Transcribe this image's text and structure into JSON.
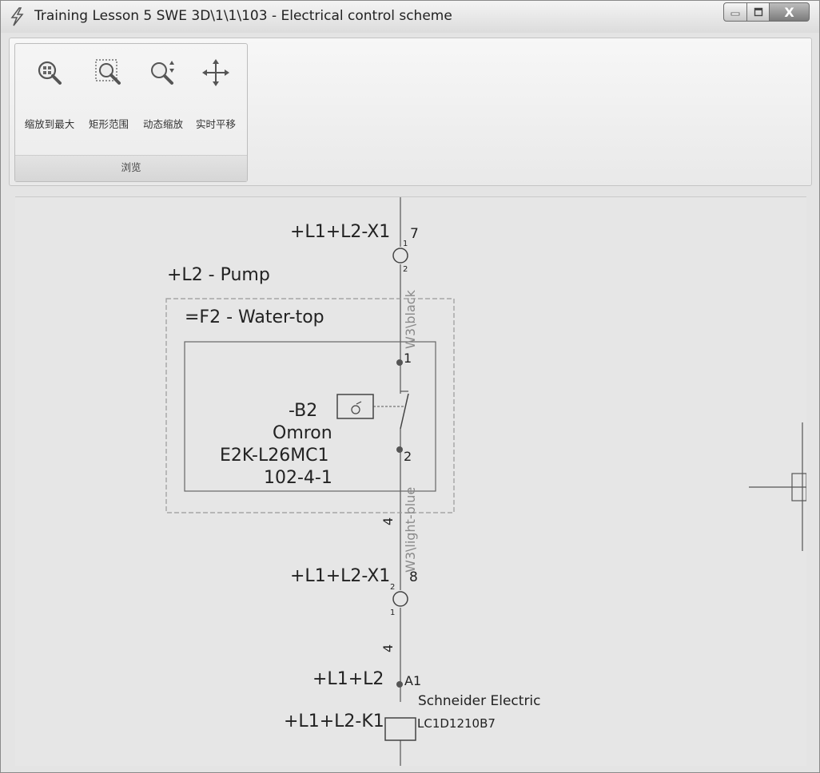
{
  "window": {
    "title": "Training Lesson 5 SWE 3D\\1\\1\\103 - Electrical control scheme",
    "close_glyph": "X"
  },
  "ribbon": {
    "group_label": "浏览",
    "tools": [
      {
        "label": "缩放到最大",
        "icon": "zoom-extents-icon"
      },
      {
        "label": "矩形范围",
        "icon": "zoom-window-icon"
      },
      {
        "label": "动态缩放",
        "icon": "dynamic-zoom-icon"
      },
      {
        "label": "实时平移",
        "icon": "pan-icon"
      }
    ]
  },
  "schematic": {
    "terminal_top_ref": "+L1+L2-X1",
    "terminal_top_num": "7",
    "terminal_top_pin1": "1",
    "terminal_top_pin2": "2",
    "location_label": "+L2 - Pump",
    "function_label": "=F2 - Water-top",
    "wire_top_label": "W3\\black",
    "contact_pin_top": "1",
    "contact_pin_bottom": "2",
    "device_tag": "-B2",
    "device_maker": "Omron",
    "device_model": "E2K-L26MC1",
    "device_location": "102-4-1",
    "wire_bottom_label": "W3\\light-blue",
    "wire_num_upper": "4",
    "terminal_bottom_ref": "+L1+L2-X1",
    "terminal_bottom_num": "8",
    "terminal_bottom_pin2": "2",
    "terminal_bottom_pin1": "1",
    "wire_num_lower": "4",
    "coil_location": "+L1+L2",
    "coil_pin": "A1",
    "coil_maker": "Schneider Electric",
    "coil_tag": "+L1+L2-K1",
    "coil_model": "LC1D1210B7"
  }
}
